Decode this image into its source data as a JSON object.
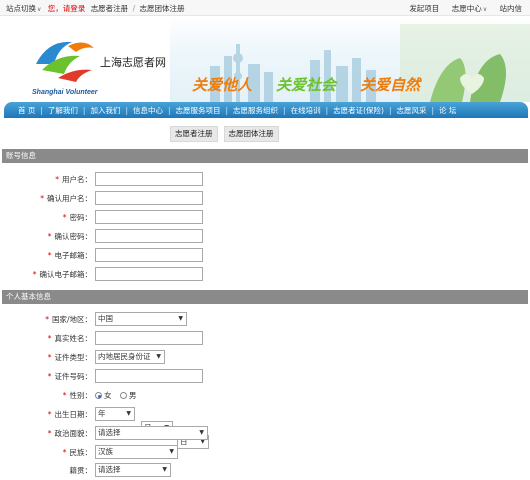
{
  "topbar": {
    "site_switch": "站点切换",
    "greeting": "您，请登录",
    "register_volunteer": "志愿者注册",
    "slash": "/",
    "register_group": "志愿团体注册",
    "right_links": [
      "发起项目",
      "志愿中心",
      "站内信"
    ]
  },
  "brand": {
    "name_cn": "上海志愿者网",
    "name_en": "Shanghai Volunteer",
    "slogans": [
      "关爱他人",
      "关爱社会",
      "关爱自然"
    ]
  },
  "nav": {
    "items": [
      "首 页",
      "了解我们",
      "加入我们",
      "信息中心",
      "志愿服务项目",
      "志愿服务组织",
      "在线培训",
      "志愿者证(保险)",
      "志愿风采",
      "论 坛"
    ]
  },
  "reg_tabs": [
    "志愿者注册",
    "志愿团体注册"
  ],
  "sections": {
    "account": "账号信息",
    "personal": "个人基本信息"
  },
  "account_fields": [
    {
      "label": "用户名：",
      "value": ""
    },
    {
      "label": "确认用户名：",
      "value": ""
    },
    {
      "label": "密码：",
      "value": ""
    },
    {
      "label": "确认密码：",
      "value": ""
    },
    {
      "label": "电子邮箱：",
      "value": ""
    },
    {
      "label": "确认电子邮箱：",
      "value": ""
    }
  ],
  "personal": {
    "country": {
      "label": "国家/地区：",
      "value": "中国"
    },
    "real_name": {
      "label": "真实姓名：",
      "value": ""
    },
    "id_type": {
      "label": "证件类型：",
      "value": "内地居民身份证"
    },
    "id_number": {
      "label": "证件号码：",
      "value": ""
    },
    "gender": {
      "label": "性别：",
      "options": [
        "女",
        "男"
      ],
      "selected": "女"
    },
    "birth": {
      "label": "出生日期：",
      "year": "年",
      "month": "月",
      "day": "日"
    },
    "political": {
      "label": "政治面貌：",
      "value": "请选择"
    },
    "ethnicity": {
      "label": "民族：",
      "value": "汉族"
    },
    "native_place": {
      "label": "籍贯：",
      "value": "请选择"
    }
  },
  "colors": {
    "nav_blue": "#1e76b8",
    "required_red": "#d60000",
    "section_gray": "#8a8a8a",
    "slogan_orange": "#f07c0a",
    "slogan_green": "#6bc22e"
  }
}
